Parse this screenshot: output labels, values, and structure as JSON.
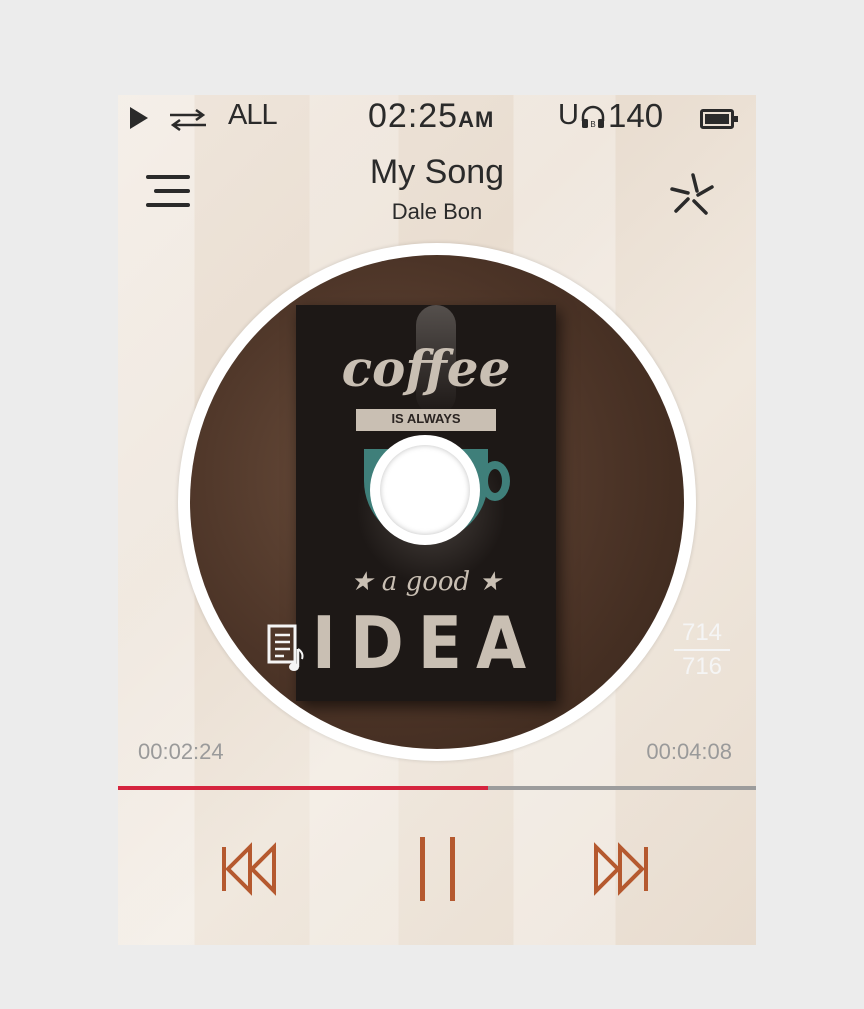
{
  "status_bar": {
    "repeat_mode": "ALL",
    "time": "02:25",
    "time_suffix": "AM",
    "output_label": "U",
    "volume": "140",
    "icons": [
      "play-icon",
      "repeat-icon",
      "headphone-icon",
      "battery-icon"
    ]
  },
  "header": {
    "title": "My Song",
    "artist": "Dale Bon",
    "icons": [
      "menu-icon",
      "shuffle-icon"
    ]
  },
  "album_art": {
    "line1": "coffee",
    "line2": "IS ALWAYS",
    "line3": "★ a good ★",
    "line4": "IDEA"
  },
  "track_count": {
    "current": "714",
    "total": "716"
  },
  "playback": {
    "elapsed": "00:02:24",
    "duration": "00:04:08",
    "progress_fraction": 0.58,
    "state": "playing"
  },
  "controls": {
    "icons": [
      "previous-icon",
      "pause-icon",
      "next-icon",
      "lyrics-icon"
    ]
  },
  "colors": {
    "accent_red": "#d5243e",
    "control_orange": "#b5592f",
    "text_dark": "#2a2a2a",
    "time_gray": "#9a9a9a"
  }
}
